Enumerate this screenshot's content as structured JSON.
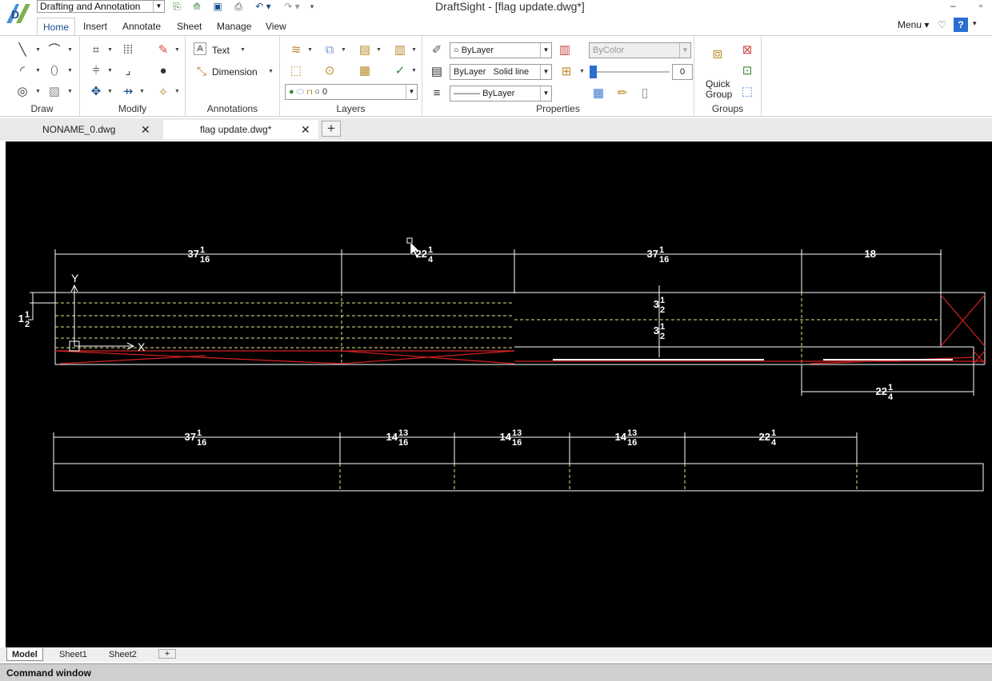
{
  "titlebar": {
    "workspace": "Drafting and Annotation",
    "title": "DraftSight - [flag update.dwg*]",
    "minimize": "–",
    "restore": "▫"
  },
  "ribbon_tabs": [
    {
      "label": "Home",
      "active": true
    },
    {
      "label": "Insert"
    },
    {
      "label": "Annotate"
    },
    {
      "label": "Sheet"
    },
    {
      "label": "Manage"
    },
    {
      "label": "View"
    }
  ],
  "menu_right": {
    "menu": "Menu",
    "help": "?"
  },
  "groups": {
    "draw": "Draw",
    "modify": "Modify",
    "annotations": "Annotations",
    "layers": "Layers",
    "properties": "Properties",
    "groups": "Groups"
  },
  "annotations": {
    "text": "Text",
    "dimension": "Dimension"
  },
  "layers": {
    "current_layer": "0"
  },
  "properties": {
    "color": "ByLayer",
    "linestyle_layer": "ByLayer",
    "linestyle_name": "Solid line",
    "lineweight": "ByLayer",
    "print_style": "ByColor",
    "transparency": "0"
  },
  "groups_panel": {
    "quick_group_line1": "Quick",
    "quick_group_line2": "Group"
  },
  "doc_tabs": [
    {
      "label": "NONAME_0.dwg",
      "active": false
    },
    {
      "label": "flag update.dwg*",
      "active": true
    }
  ],
  "drawing": {
    "dims_top": [
      {
        "whole": "37",
        "num": "1",
        "den": "16"
      },
      {
        "whole": "22",
        "num": "1",
        "den": "4"
      },
      {
        "whole": "37",
        "num": "1",
        "den": "16"
      },
      {
        "whole": "18",
        "num": "",
        "den": ""
      }
    ],
    "dim_left": {
      "whole": "1",
      "num": "1",
      "den": "2"
    },
    "dim_vert_upper": {
      "whole": "3",
      "num": "1",
      "den": "2"
    },
    "dim_vert_lower": {
      "whole": "3",
      "num": "1",
      "den": "2"
    },
    "dim_right_bottom": {
      "whole": "22",
      "num": "1",
      "den": "4"
    },
    "dims_lower": [
      {
        "whole": "37",
        "num": "1",
        "den": "16"
      },
      {
        "whole": "14",
        "num": "13",
        "den": "16"
      },
      {
        "whole": "14",
        "num": "13",
        "den": "16"
      },
      {
        "whole": "14",
        "num": "13",
        "den": "16"
      },
      {
        "whole": "22",
        "num": "1",
        "den": "4"
      }
    ],
    "ucs_y": "Y",
    "ucs_x": "X"
  },
  "sheet_tabs": [
    {
      "label": "Model",
      "active": true
    },
    {
      "label": "Sheet1"
    },
    {
      "label": "Sheet2"
    }
  ],
  "sheet_add": "+",
  "command_window": "Command window",
  "colors": {
    "canvas": "#000000",
    "accent": "#1a4e8a",
    "dimension": "#ffffff",
    "hidden_lines": "#e6e68a",
    "red_lines": "#d42020"
  }
}
